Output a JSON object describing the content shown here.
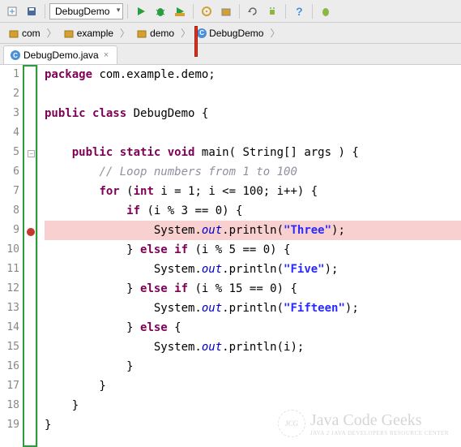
{
  "toolbar": {
    "dropdown_label": "DebugDemo"
  },
  "breadcrumb": {
    "items": [
      "com",
      "example",
      "demo",
      "DebugDemo"
    ]
  },
  "tab": {
    "label": "DebugDemo.java"
  },
  "code": {
    "lines": [
      {
        "n": 1,
        "html": "<span class='kw'>package</span> com.example.demo;"
      },
      {
        "n": 2,
        "html": ""
      },
      {
        "n": 3,
        "html": "<span class='kw'>public</span> <span class='kw'>class</span> DebugDemo {"
      },
      {
        "n": 4,
        "html": ""
      },
      {
        "n": 5,
        "html": "    <span class='kw'>public</span> <span class='kw'>static</span> <span class='kw'>void</span> main( String[] args ) {"
      },
      {
        "n": 6,
        "html": "        <span class='cm'>// Loop numbers from 1 to 100</span>"
      },
      {
        "n": 7,
        "html": "        <span class='kw'>for</span> (<span class='kw'>int</span> i = 1; i &lt;= 100; i++) {"
      },
      {
        "n": 8,
        "html": "            <span class='kw'>if</span> (i % 3 == 0) {"
      },
      {
        "n": 9,
        "html": "                System.<span class='fld'>out</span>.println(<span class='str'>\"Three\"</span>);",
        "bp": true
      },
      {
        "n": 10,
        "html": "            } <span class='kw'>else</span> <span class='kw'>if</span> (i % 5 == 0) {"
      },
      {
        "n": 11,
        "html": "                System.<span class='fld'>out</span>.println(<span class='str'>\"Five\"</span>);"
      },
      {
        "n": 12,
        "html": "            } <span class='kw'>else</span> <span class='kw'>if</span> (i % 15 == 0) {"
      },
      {
        "n": 13,
        "html": "                System.<span class='fld'>out</span>.println(<span class='str'>\"Fifteen\"</span>);"
      },
      {
        "n": 14,
        "html": "            } <span class='kw'>else</span> {"
      },
      {
        "n": 15,
        "html": "                System.<span class='fld'>out</span>.println(i);"
      },
      {
        "n": 16,
        "html": "            }"
      },
      {
        "n": 17,
        "html": "        }"
      },
      {
        "n": 18,
        "html": "    }"
      },
      {
        "n": 19,
        "html": "}"
      }
    ]
  },
  "watermark": {
    "logo_text": "JCG",
    "main": "Java Code Geeks",
    "sub": "JAVA 2 JAVA DEVELOPERS RESOURCE CENTER"
  }
}
